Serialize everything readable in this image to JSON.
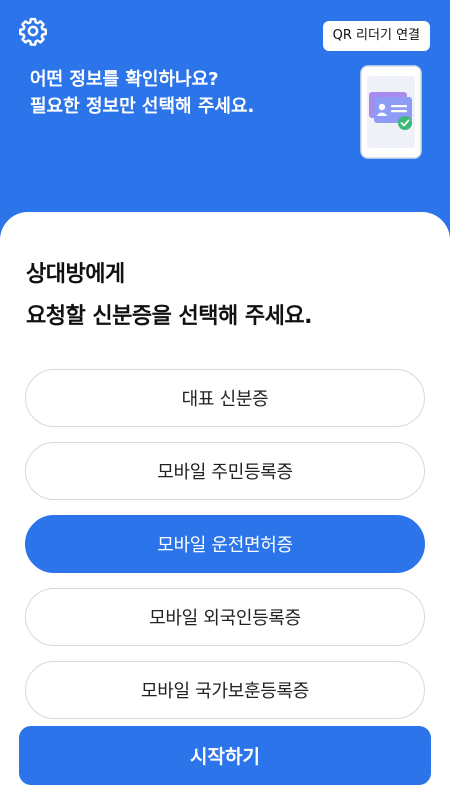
{
  "header": {
    "settings_icon": "gear-icon",
    "qr_button_label": "QR 리더기 연결",
    "headline_line1": "어떤 정보를 확인하나요?",
    "headline_line2": "필요한 정보만 선택해 주세요.",
    "illustration": "phone-id-card-check-illustration"
  },
  "main": {
    "prompt_line1": "상대방에게",
    "prompt_line2": "요청할 신분증을 선택해 주세요.",
    "options": [
      {
        "label": "대표 신분증",
        "selected": false
      },
      {
        "label": "모바일 주민등록증",
        "selected": false
      },
      {
        "label": "모바일 운전면허증",
        "selected": true
      },
      {
        "label": "모바일 외국인등록증",
        "selected": false
      },
      {
        "label": "모바일 국가보훈등록증",
        "selected": false
      }
    ],
    "start_button_label": "시작하기"
  },
  "colors": {
    "primary": "#2b74ea",
    "background": "#ffffff",
    "option_border": "#d9d9d9",
    "check_green": "#3cb878"
  }
}
